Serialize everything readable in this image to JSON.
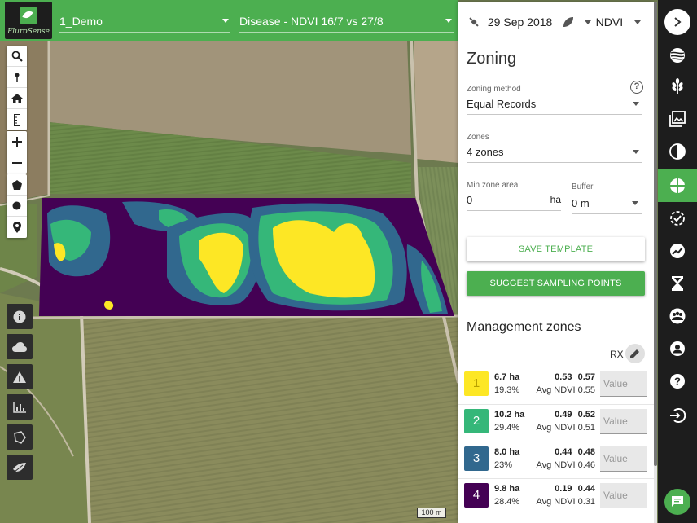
{
  "brand": {
    "logo_text": "FluroSense"
  },
  "topbar": {
    "farm": "1_Demo",
    "layer": "Disease - NDVI 16/7 vs 27/8"
  },
  "map": {
    "scale_label": "100 m"
  },
  "panel": {
    "date": "29 Sep 2018",
    "index": "NDVI",
    "title": "Zoning",
    "zoning_method": {
      "label": "Zoning method",
      "value": "Equal Records"
    },
    "zones": {
      "label": "Zones",
      "value": "4 zones"
    },
    "min_zone_area": {
      "label": "Min zone area",
      "value": "0",
      "unit": "ha"
    },
    "buffer": {
      "label": "Buffer",
      "value": "0 m"
    },
    "save_template": "SAVE TEMPLATE",
    "suggest_points": "SUGGEST SAMPLING POINTS",
    "mz_title": "Management zones",
    "rx_label": "RX",
    "zones_list": [
      {
        "num": "1",
        "area": "6.7 ha",
        "pct": "19.3%",
        "stats": "0.53 0.57",
        "avg": "Avg NDVI 0.55",
        "color": "#fde725",
        "text_color": "#b8a000",
        "value_placeholder": "Value"
      },
      {
        "num": "2",
        "area": "10.2 ha",
        "pct": "29.4%",
        "stats": "0.49 0.52",
        "avg": "Avg NDVI 0.51",
        "color": "#35b779",
        "text_color": "#ffffff",
        "value_placeholder": "Value"
      },
      {
        "num": "3",
        "area": "8.0 ha",
        "pct": "23%",
        "stats": "0.44 0.48",
        "avg": "Avg NDVI 0.46",
        "color": "#31688e",
        "text_color": "#ffffff",
        "value_placeholder": "Value"
      },
      {
        "num": "4",
        "area": "9.8 ha",
        "pct": "28.4%",
        "stats": "0.19 0.44",
        "avg": "Avg NDVI 0.31",
        "color": "#440154",
        "text_color": "#ffffff",
        "value_placeholder": "Value"
      }
    ]
  },
  "rail": {
    "icons": [
      "chevron-right-icon",
      "layers-icon",
      "crop-icon",
      "photos-icon",
      "contrast-icon",
      "zoning-icon",
      "check-badge-icon",
      "trend-icon",
      "hourglass-icon",
      "team-icon",
      "user-icon",
      "help-icon",
      "logout-icon"
    ],
    "active": "zoning-icon"
  }
}
